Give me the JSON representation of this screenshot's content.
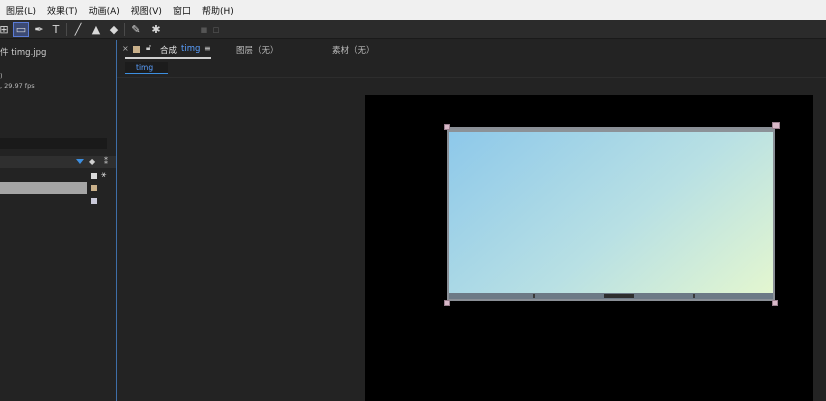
{
  "menubar": {
    "items": [
      "图层(L)",
      "效果(T)",
      "动画(A)",
      "视图(V)",
      "窗口",
      "帮助(H)"
    ]
  },
  "toolbar": {
    "tools": [
      {
        "name": "hand-tool-icon",
        "glyph": "⊞"
      },
      {
        "name": "rectangle-tool-icon",
        "glyph": "▭",
        "active": true
      },
      {
        "name": "pen-tool-icon",
        "glyph": "✒"
      },
      {
        "name": "text-tool-icon",
        "glyph": "T"
      },
      {
        "name": "brush-tool-icon",
        "glyph": "╱"
      },
      {
        "name": "clone-stamp-tool-icon",
        "glyph": "▲"
      },
      {
        "name": "eraser-tool-icon",
        "glyph": "◆"
      },
      {
        "name": "roto-brush-tool-icon",
        "glyph": "✎"
      },
      {
        "name": "puppet-pin-tool-icon",
        "glyph": "✱"
      }
    ]
  },
  "project": {
    "name": "件 timg.jpg",
    "info_line1": ")",
    "info_line2": ", 29.97 fps"
  },
  "comp": {
    "tab_prefix": "合成",
    "tab_name": "timg",
    "layer_tab": "图层（无）",
    "footage_tab": "素材（无）",
    "breadcrumb": "timg"
  },
  "colors": {
    "accent": "#3d8fe0",
    "label_tan": "#c9b08a",
    "selected_row": "#a5a5a5"
  }
}
